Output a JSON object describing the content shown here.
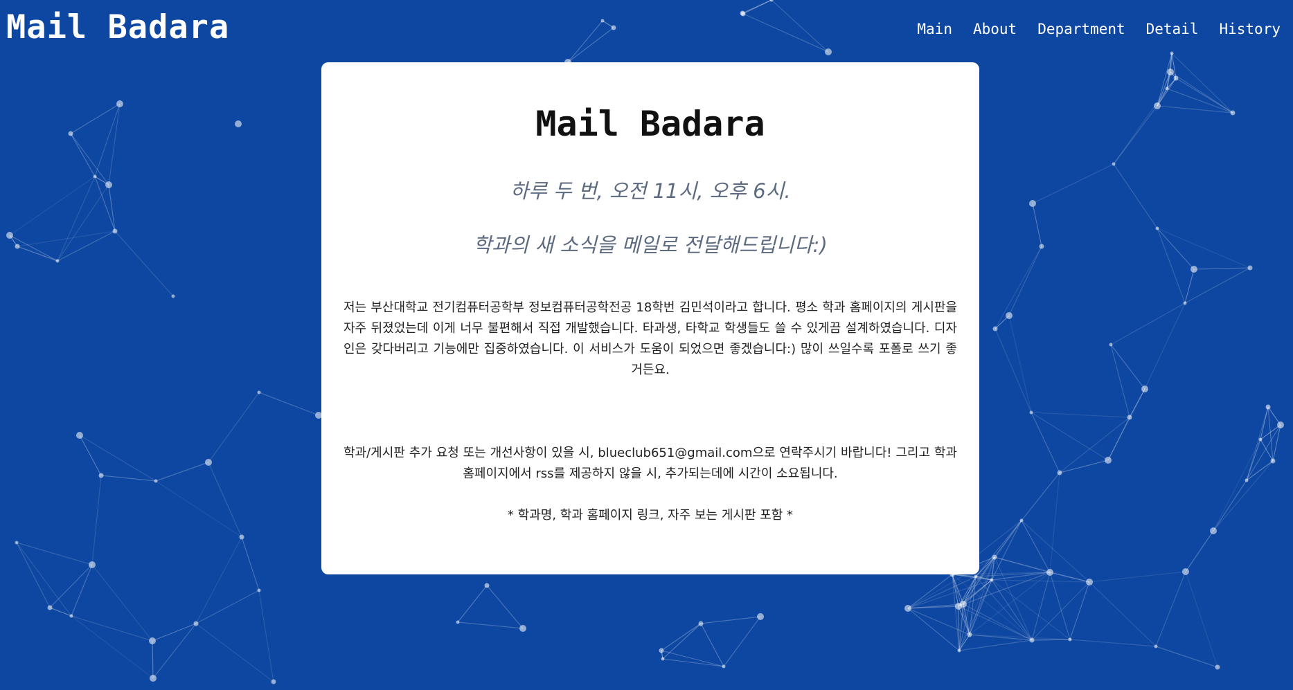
{
  "header": {
    "brand": "Mail Badara",
    "nav": [
      "Main",
      "About",
      "Department",
      "Detail",
      "History"
    ]
  },
  "card": {
    "title": "Mail Badara",
    "tagline_1": "하루 두 번, 오전 11시, 오후 6시.",
    "tagline_2": "학과의 새 소식을 메일로 전달해드립니다:)",
    "intro": "저는 부산대학교 전기컴퓨터공학부 정보컴퓨터공학전공 18학번 김민석이라고 합니다. 평소 학과 홈페이지의 게시판을 자주 뒤졌었는데 이게 너무 불편해서 직접 개발했습니다. 타과생, 타학교 학생들도 쓸 수 있게끔 설계하였습니다. 디자인은 갖다버리고 기능에만 집중하였습니다. 이 서비스가 도움이 되었으면 좋겠습니다:) 많이 쓰일수록 포폴로 쓰기 좋거든요.",
    "contact": "학과/게시판 추가 요청 또는 개선사항이 있을 시, blueclub651@gmail.com으로 연락주시기 바랍니다! 그리고 학과 홈페이지에서 rss를 제공하지 않을 시, 추가되는데에 시간이 소요됩니다.",
    "note": "* 학과명, 학과 홈페이지 링크, 자주 보는 게시판 포함 *"
  },
  "colors": {
    "background": "#0e47a1",
    "card": "#ffffff",
    "tagline": "#5c6a80"
  }
}
